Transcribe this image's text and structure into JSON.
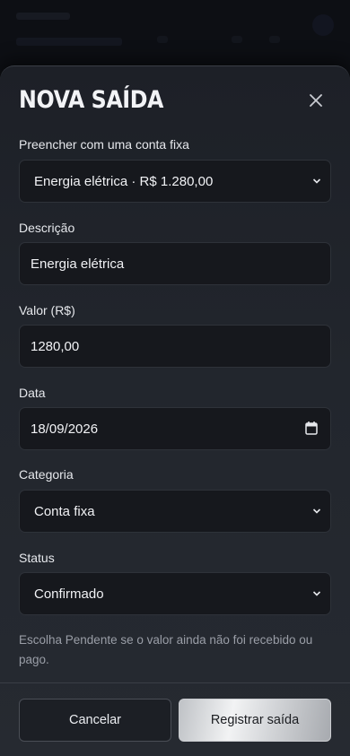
{
  "modal": {
    "title": "NOVA SAÍDA",
    "close_icon": "close-icon"
  },
  "form": {
    "fixed_account": {
      "label": "Preencher com uma conta fixa",
      "selected": "Energia elétrica · R$ 1.280,00"
    },
    "description": {
      "label": "Descrição",
      "value": "Energia elétrica"
    },
    "amount": {
      "label": "Valor (R$)",
      "value": "1280,00"
    },
    "date": {
      "label": "Data",
      "value": "18/09/2026"
    },
    "category": {
      "label": "Categoria",
      "selected": "Conta fixa"
    },
    "status": {
      "label": "Status",
      "selected": "Confirmado"
    },
    "hint": "Escolha Pendente se o valor ainda não foi recebido ou pago."
  },
  "actions": {
    "cancel_label": "Cancelar",
    "submit_label": "Registrar saída"
  },
  "colors": {
    "sheet": "#22262d",
    "field": "#16181d",
    "primary_button": "#e6e7e9"
  }
}
